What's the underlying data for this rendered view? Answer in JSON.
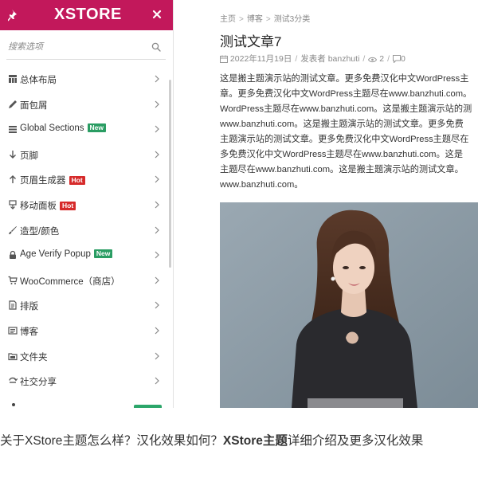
{
  "panel": {
    "brand": "XSTORE",
    "search_placeholder": "搜索选项",
    "items": [
      {
        "label": "总体布局",
        "icon": "layout-grid-icon",
        "badge": ""
      },
      {
        "label": "面包屑",
        "icon": "pen-icon",
        "badge": ""
      },
      {
        "label": "Global Sections",
        "icon": "sections-icon",
        "badge": "New"
      },
      {
        "label": "页脚",
        "icon": "arrow-down-icon",
        "badge": ""
      },
      {
        "label": "页眉生成器",
        "icon": "arrow-up-icon",
        "badge": "Hot"
      },
      {
        "label": "移动面板",
        "icon": "mobile-panel-icon",
        "badge": "Hot"
      },
      {
        "label": "造型/颜色",
        "icon": "brush-icon",
        "badge": ""
      },
      {
        "label": "Age Verify Popup",
        "icon": "lock-icon",
        "badge": "New"
      },
      {
        "label": "WooCommerce（商店）",
        "icon": "cart-icon",
        "badge": ""
      },
      {
        "label": "排版",
        "icon": "typography-icon",
        "badge": ""
      },
      {
        "label": "博客",
        "icon": "blog-icon",
        "badge": ""
      },
      {
        "label": "文件夹",
        "icon": "folder-icon",
        "badge": ""
      },
      {
        "label": "社交分享",
        "icon": "share-icon",
        "badge": ""
      }
    ],
    "colors": {
      "header": "#c2185b",
      "new_badge": "#2a9d63",
      "hot_badge": "#d62b2b"
    }
  },
  "preview": {
    "breadcrumb": [
      "主页",
      "博客",
      "测试3分类"
    ],
    "title": "测试文章7",
    "date": "2022年11月19日",
    "author_prefix": "发表者",
    "author": "banzhuti",
    "views": "2",
    "comments": "0",
    "body_lines": [
      "这是搬主题演示站的测试文章。更多免费汉化中文WordPress主",
      "章。更多免费汉化中文WordPress主题尽在www.banzhuti.com。",
      "WordPress主题尽在www.banzhuti.com。这是搬主题演示站的测",
      "www.banzhuti.com。这是搬主题演示站的测试文章。更多免费",
      "主题演示站的测试文章。更多免费汉化中文WordPress主题尽在",
      "多免费汉化中文WordPress主题尽在www.banzhuti.com。这是",
      "主题尽在www.banzhuti.com。这是搬主题演示站的测试文章。",
      "www.banzhuti.com。"
    ]
  },
  "caption": {
    "part1": "关于XStore主题怎么样？汉化效果如何？",
    "bold": "XStore主题",
    "part2": "详细介绍及更多汉化效果"
  }
}
